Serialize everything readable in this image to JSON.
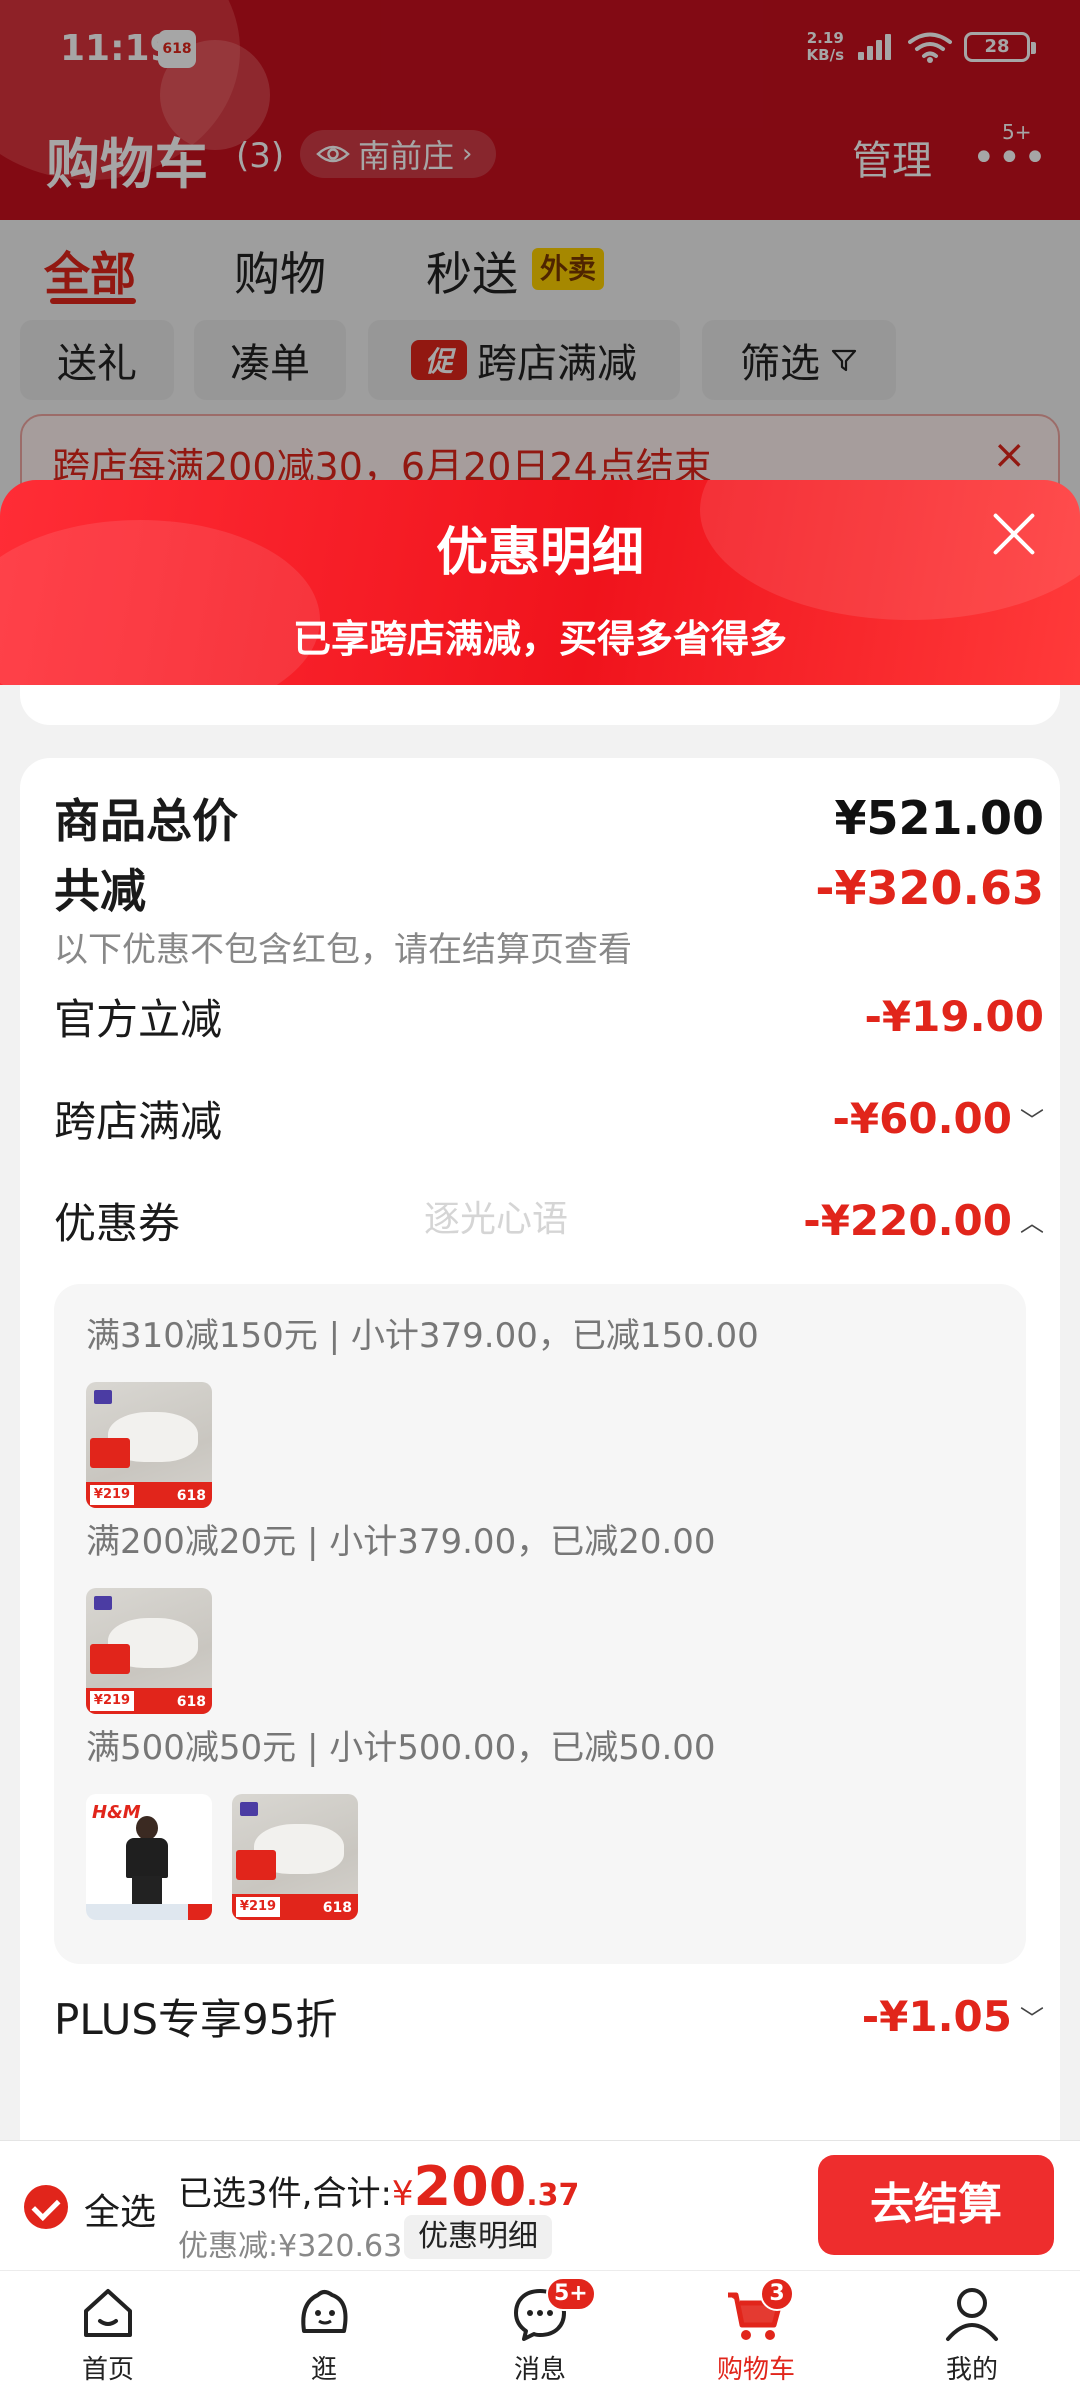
{
  "status_bar": {
    "time": "11:19",
    "badge": "618",
    "net_speed_value": "2.19",
    "net_speed_unit": "KB/s",
    "battery": "28"
  },
  "header": {
    "title": "购物车",
    "count": "(3)",
    "location": "南前庄",
    "manage": "管理",
    "more_badge": "5+"
  },
  "tabs": [
    {
      "label": "全部",
      "active": true
    },
    {
      "label": "购物",
      "active": false
    },
    {
      "label": "秒送",
      "active": false,
      "badge": "外卖"
    }
  ],
  "filters": {
    "gift": "送礼",
    "add_on": "凑单",
    "promo_tag": "促",
    "cross_store": "跨店满减",
    "filter": "筛选"
  },
  "promo_banner": {
    "text": "跨店每满200减30，6月20日24点结束",
    "close": "×"
  },
  "sheet": {
    "title": "优惠明细",
    "subtitle": "已享跨店满减，买得多省得多",
    "rows": {
      "subtotal_label": "商品总价",
      "subtotal_value": "¥521.00",
      "total_discount_label": "共减",
      "total_discount_value": "-¥320.63",
      "note": "以下优惠不包含红包，请在结算页查看",
      "official_label": "官方立减",
      "official_value": "-¥19.00",
      "cross_store_label": "跨店满减",
      "cross_store_value": "-¥60.00",
      "coupon_label": "优惠券",
      "coupon_value": "-¥220.00",
      "plus_label": "PLUS专享95折",
      "plus_value": "-¥1.05"
    },
    "watermark": "逐光心语",
    "coupons": [
      {
        "text": "满310减150元 | 小计379.00，已减150.00"
      },
      {
        "text": "满200减20元 | 小计379.00，已减20.00"
      },
      {
        "text": "满500减50元 | 小计500.00，已减50.00"
      }
    ],
    "thumb_price": "¥219",
    "thumb_sale": "618",
    "thumb_brand": "H&M"
  },
  "checkout": {
    "select_all": "全选",
    "summary_prefix": "已选3件,合计:",
    "currency": "¥",
    "total_int": "200",
    "total_dec": ".37",
    "saved": "优惠减:¥320.63",
    "detail": "优惠明细",
    "button": "去结算"
  },
  "nav": [
    {
      "label": "首页",
      "icon": "home-icon"
    },
    {
      "label": "逛",
      "icon": "browse-icon"
    },
    {
      "label": "消息",
      "icon": "message-icon",
      "badge": "5+"
    },
    {
      "label": "购物车",
      "icon": "cart-icon",
      "badge": "3",
      "active": true
    },
    {
      "label": "我的",
      "icon": "profile-icon"
    }
  ],
  "colors": {
    "brand_red": "#e1251b",
    "header_red": "#c8101e",
    "checkout_red": "#ee2d2d"
  }
}
